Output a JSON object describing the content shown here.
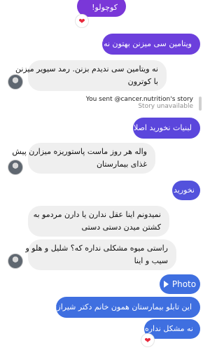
{
  "colors": {
    "outgoing_top": "#7a37d8",
    "outgoing_mid": "#5b46dc",
    "outgoing_bottom": "#3f6fe0",
    "incoming": "#efefef",
    "heart": "#e8283a"
  },
  "messages": [
    {
      "id": "m0",
      "dir": "out",
      "text": "کوچولو!",
      "reaction": "heart-icon"
    },
    {
      "id": "m1",
      "dir": "out",
      "text": "ویتامین سی میزنن بهتون نه؟"
    },
    {
      "id": "m2",
      "dir": "in",
      "lines": [
        "نه ویتامین سی ندیدم بزنن. رمد سیویر میزنن",
        "با کوترون"
      ]
    },
    {
      "id": "m3",
      "dir": "out",
      "text": "لبنیات نخورید اصلا"
    },
    {
      "id": "m4",
      "dir": "in",
      "lines": [
        "واله هر روز ماست پاستوریزه میزارن پیش",
        "غذای بیمارستان"
      ]
    },
    {
      "id": "m5",
      "dir": "out",
      "text": "نخورید"
    },
    {
      "id": "m6",
      "dir": "in",
      "lines": [
        "نمیدونم اینا عقل ندارن یا دارن مردمو به",
        "کشتن میدن دستی دستی"
      ]
    },
    {
      "id": "m7",
      "dir": "in",
      "lines": [
        "راستی میوه مشکلی نداره که؟ شلیل و هلو و",
        "سیب و اینا"
      ]
    },
    {
      "id": "m8",
      "dir": "out",
      "text": "این تابلو بیمارستان همون خانم دکتر شیرازی"
    },
    {
      "id": "m9",
      "dir": "out",
      "text": "نه مشکل نداره",
      "reaction": "heart-icon"
    }
  ],
  "story": {
    "title": "You sent @cancer.nutrition's story",
    "subtitle": "Story unavailable"
  },
  "photo_button": {
    "label": "Photo",
    "icon": "play-icon"
  },
  "reaction_glyph": "❤"
}
